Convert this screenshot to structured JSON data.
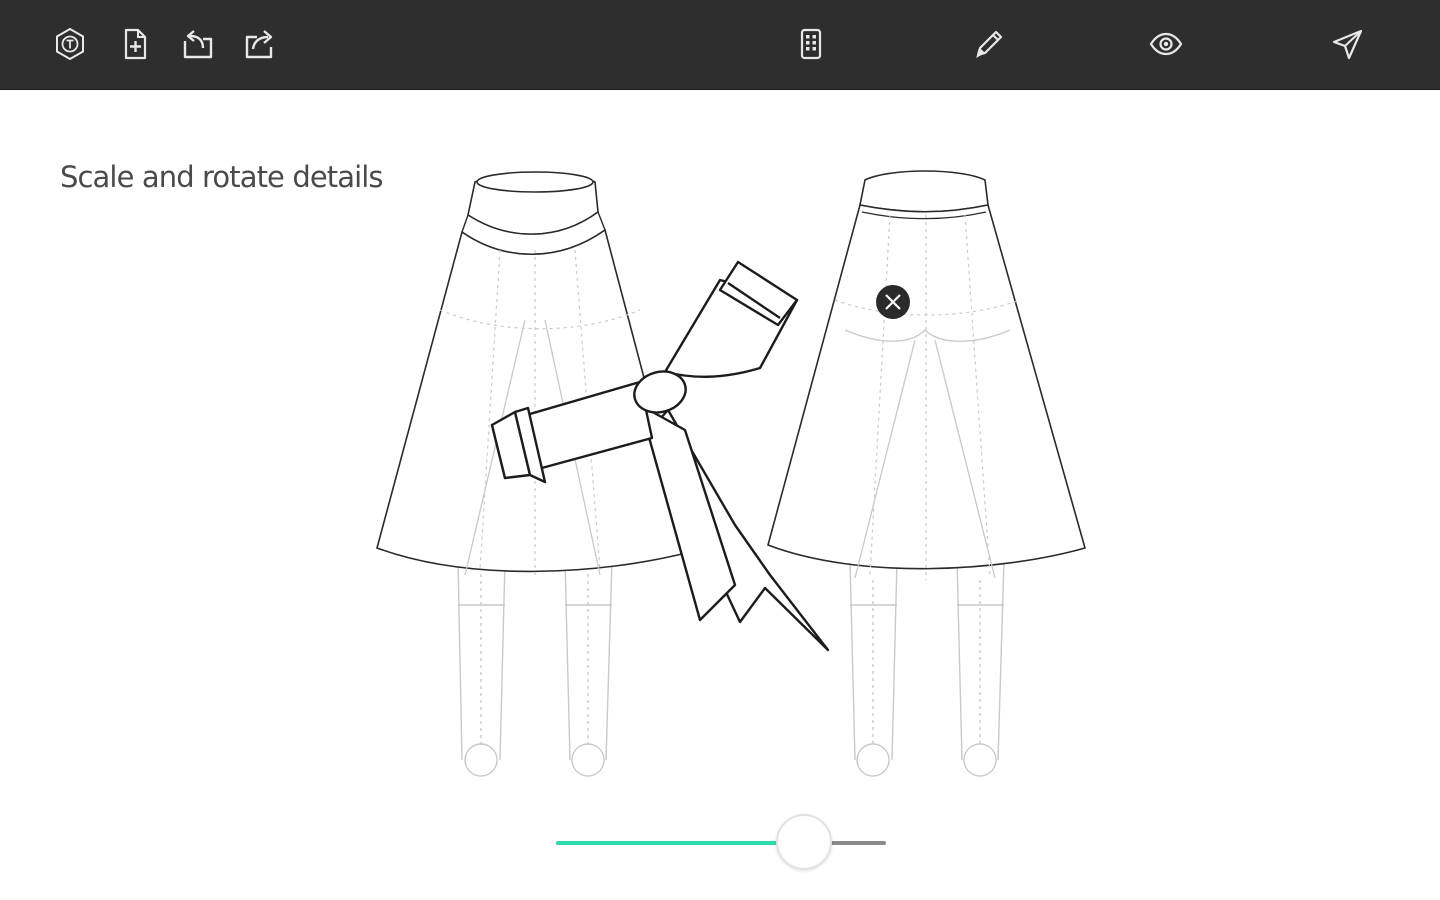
{
  "app": {
    "hint": "Scale and rotate details"
  },
  "toolbar": {
    "left_icons": [
      "logo-icon",
      "new-file-icon",
      "undo-icon",
      "share-icon"
    ],
    "right_icons": [
      "templates-icon",
      "pencil-icon",
      "eye-icon",
      "send-icon"
    ]
  },
  "slider": {
    "value": 0.75
  },
  "colors": {
    "toolbar_bg": "#2e2e2e",
    "icon": "#e8e8e8",
    "slider_fill": "#2bdcad",
    "slider_track": "#8a8a8a",
    "text": "#4a4a4a"
  }
}
